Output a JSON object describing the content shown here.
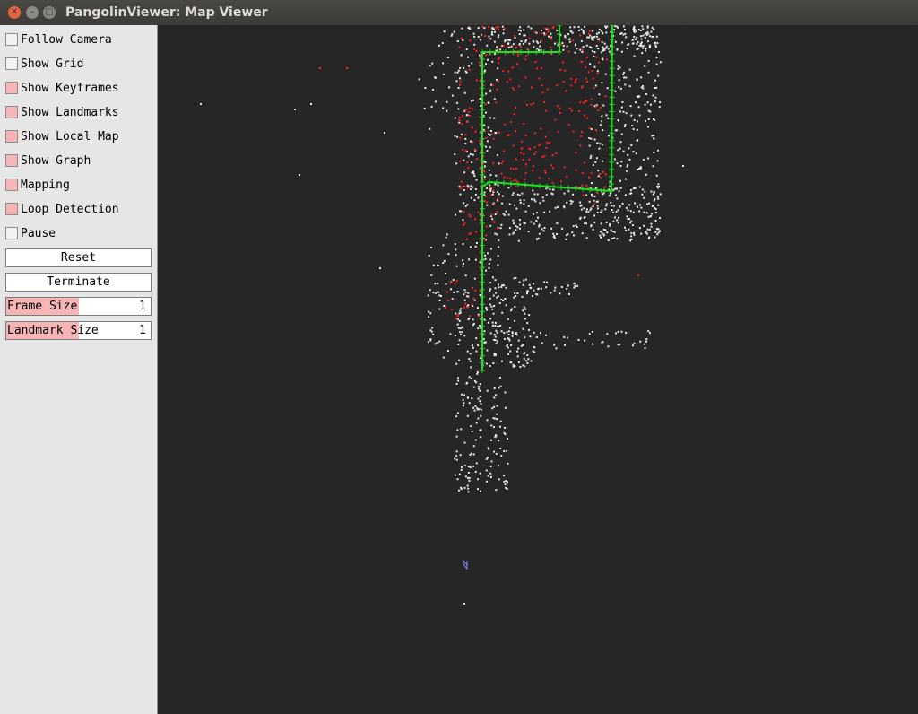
{
  "window": {
    "title": "PangolinViewer: Map Viewer",
    "close_glyph": "✕",
    "min_glyph": "–",
    "max_glyph": "▢"
  },
  "panel": {
    "checkboxes": [
      {
        "label": "Follow Camera",
        "checked": false
      },
      {
        "label": "Show Grid",
        "checked": false
      },
      {
        "label": "Show Keyframes",
        "checked": true
      },
      {
        "label": "Show Landmarks",
        "checked": true
      },
      {
        "label": "Show Local Map",
        "checked": true
      },
      {
        "label": "Show Graph",
        "checked": true
      },
      {
        "label": "Mapping",
        "checked": true
      },
      {
        "label": "Loop Detection",
        "checked": true
      },
      {
        "label": "Pause",
        "checked": false
      }
    ],
    "buttons": {
      "reset": "Reset",
      "terminate": "Terminate"
    },
    "sliders": [
      {
        "label": "Frame Size",
        "value": "1",
        "fraction": 0.5
      },
      {
        "label": "Landmark Size",
        "value": "1",
        "fraction": 0.5
      }
    ]
  },
  "colors": {
    "landmark": "#e8e8e8",
    "local_map": "#ff2020",
    "keyframe": "#22dd22",
    "camera": "#8c8cff",
    "checked": "#f7b5b5"
  }
}
